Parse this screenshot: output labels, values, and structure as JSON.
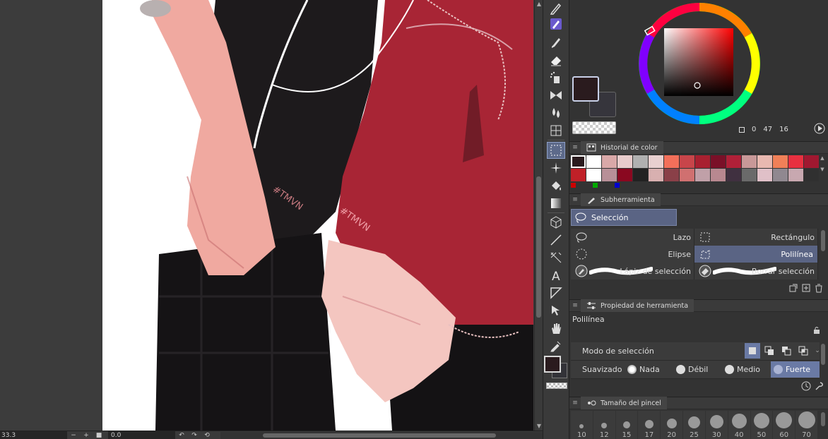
{
  "statusbar": {
    "zoom": "33.3",
    "angle": "0.0",
    "zoom_out": "−",
    "zoom_in": "+"
  },
  "color": {
    "main_hex": "#2a1b1e",
    "sub_hex": "#36353c",
    "h": "0",
    "s": "47",
    "v": "16"
  },
  "panels": {
    "color_history": "Historial de color",
    "subtool": "Subherramienta",
    "tool_property": "Propiedad de herramienta",
    "brush_size": "Tamaño del pincel"
  },
  "history_colors": [
    "#2a1b1e",
    "#ffffff",
    "#d9a8a8",
    "#e8cccc",
    "#b0b0b0",
    "#e8d0d0",
    "#f26f5a",
    "#c8454a",
    "#a82030",
    "#7a1028",
    "#b02038",
    "#c89898",
    "#e8b8b0",
    "#f08058",
    "#e83040",
    "#a01830",
    "#c02028",
    "#ffffff",
    "#b89098",
    "#8a0820",
    "#222222",
    "#d8b0b0",
    "#8a4048",
    "#d07070",
    "#c0a0a8",
    "#b88890",
    "#403040",
    "#6a6a6a",
    "#e0c0c8",
    "#908890",
    "#c8a8b0",
    "#303030"
  ],
  "subtool": {
    "group": "Selección",
    "items": [
      {
        "label": "Lazo",
        "active": false
      },
      {
        "label": "Rectángulo",
        "active": false
      },
      {
        "label": "Elipse",
        "active": false
      },
      {
        "label": "Polilínea",
        "active": true
      },
      {
        "label": "Lápiz de selección",
        "active": false
      },
      {
        "label": "Borrar selección",
        "active": false
      }
    ]
  },
  "tool_property": {
    "tool_name": "Polilínea",
    "mode_label": "Modo de selección",
    "smooth_label": "Suavizado",
    "smooth_options": [
      {
        "label": "Nada",
        "active": false
      },
      {
        "label": "Débil",
        "active": false
      },
      {
        "label": "Medio",
        "active": false
      },
      {
        "label": "Fuerte",
        "active": true
      }
    ]
  },
  "brush_sizes": [
    "10",
    "12",
    "15",
    "17",
    "20",
    "25",
    "30",
    "40",
    "50",
    "60",
    "70"
  ]
}
